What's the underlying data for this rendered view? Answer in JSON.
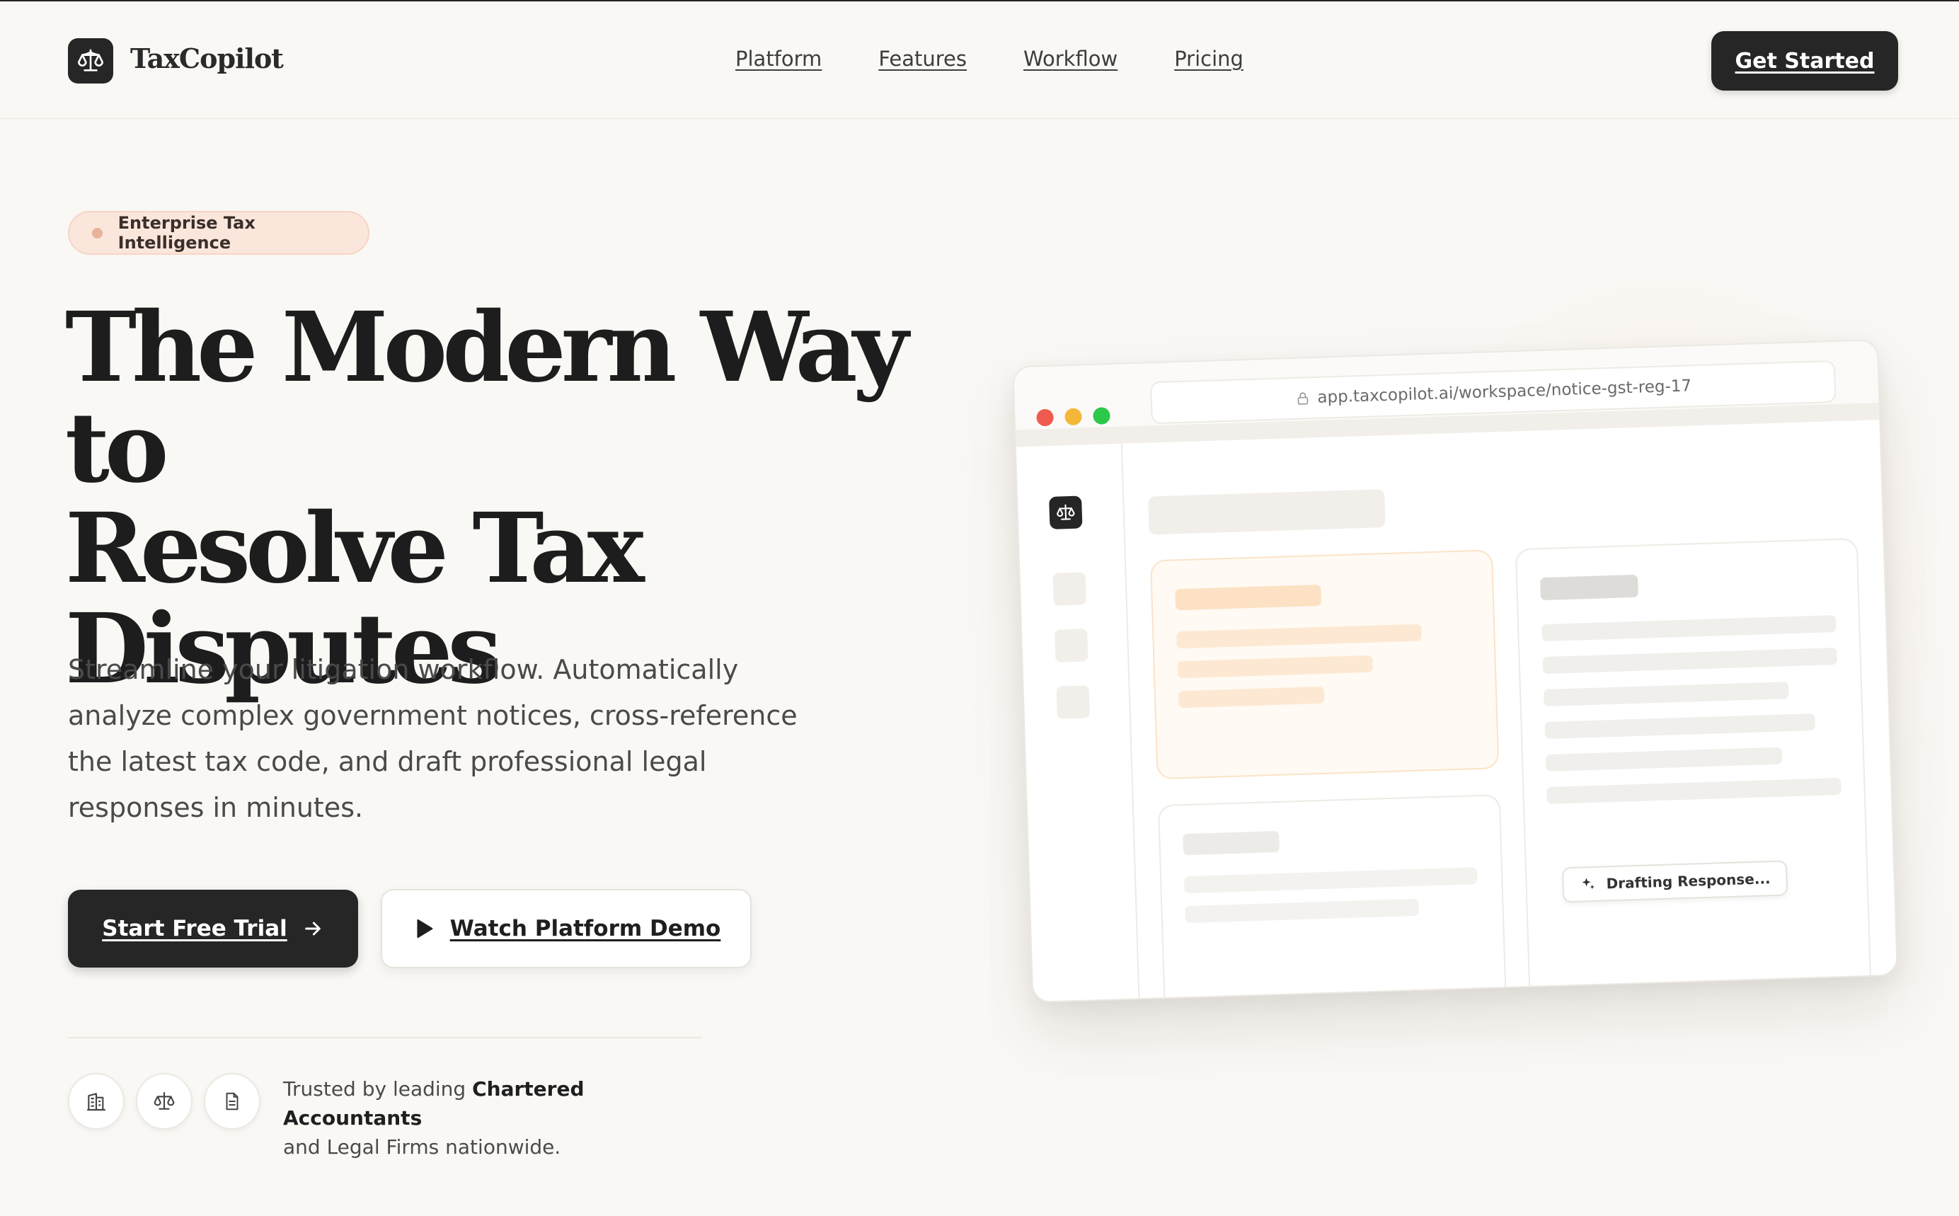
{
  "brand": {
    "name": "TaxCopilot",
    "logo_icon": "scales-icon"
  },
  "nav": {
    "links": [
      "Platform",
      "Features",
      "Workflow",
      "Pricing"
    ],
    "cta": "Get Started"
  },
  "hero": {
    "badge": "Enterprise Tax Intelligence",
    "headline_lines": [
      "The Modern Way to",
      "Resolve Tax",
      "Disputes"
    ],
    "subheadline": "Streamline your litigation workflow. Automatically analyze complex government notices, cross-reference the latest tax code, and draft professional legal responses in minutes.",
    "primary_cta": "Start Free Trial",
    "secondary_cta": "Watch Platform Demo"
  },
  "trust": {
    "icons": [
      "building-icon",
      "scales-icon",
      "document-icon"
    ],
    "text_before": "Trusted by leading ",
    "text_bold": "Chartered Accountants",
    "text_after": "and Legal Firms nationwide."
  },
  "mockup": {
    "url": "app.taxcopilot.ai/workspace/notice-gst-reg-17",
    "status_chip": "Drafting Response...",
    "window_dot_colors": [
      "#ef5a4f",
      "#f4b73a",
      "#2cc84a"
    ]
  },
  "colors": {
    "background": "#faf8f5",
    "primary": "#262626",
    "badge_bg": "#fbe6dc",
    "accent_warm": "#fde6cc"
  }
}
